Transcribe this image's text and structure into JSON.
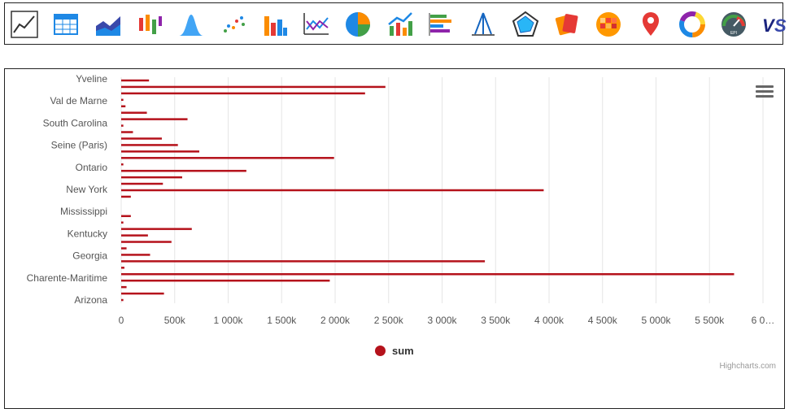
{
  "toolbar": {
    "icons": [
      "line-chart-icon",
      "table-icon",
      "area-chart-icon",
      "candlestick-icon",
      "bell-curve-icon",
      "scatter-icon",
      "column-chart-icon",
      "multi-line-icon",
      "pie-chart-icon",
      "combo-chart-icon",
      "bar-list-icon",
      "tripod-icon",
      "radar-icon",
      "cards-icon",
      "heatmap-icon",
      "map-pin-icon",
      "donut-icon",
      "gauge-icon",
      "versus-icon"
    ],
    "colors": {
      "red": "#e53935",
      "orange": "#fb8c00",
      "blue": "#1e88e5",
      "green": "#43a047",
      "navy": "#1a237e"
    }
  },
  "chart": {
    "menu_icon": "hamburger-menu-icon",
    "credits": "Highcharts.com"
  },
  "chart_data": {
    "type": "bar",
    "orientation": "horizontal",
    "series": [
      {
        "name": "sum",
        "color": "#b5121b"
      }
    ],
    "y_tick_labels": [
      "Yveline",
      "Val de Marne",
      "South Carolina",
      "Seine (Paris)",
      "Ontario",
      "New York",
      "Mississippi",
      "Kentucky",
      "Georgia",
      "Charente-Maritime",
      "Arizona"
    ],
    "values": [
      260000,
      2470000,
      2280000,
      20000,
      40000,
      240000,
      620000,
      20000,
      110000,
      380000,
      530000,
      730000,
      1990000,
      20000,
      1170000,
      570000,
      390000,
      3950000,
      90000,
      0,
      0,
      90000,
      20000,
      660000,
      250000,
      470000,
      50000,
      270000,
      3400000,
      30000,
      5730000,
      1950000,
      50000,
      400000,
      20000
    ],
    "x_tick_labels": [
      "0",
      "500k",
      "1 000k",
      "1 500k",
      "2 000k",
      "2 500k",
      "3 000k",
      "3 500k",
      "4 000k",
      "4 500k",
      "5 000k",
      "5 500k",
      "6 0…"
    ],
    "xlim": [
      0,
      6000000
    ],
    "legend": {
      "label": "sum",
      "placement": "bottom-center"
    },
    "grid": true
  }
}
